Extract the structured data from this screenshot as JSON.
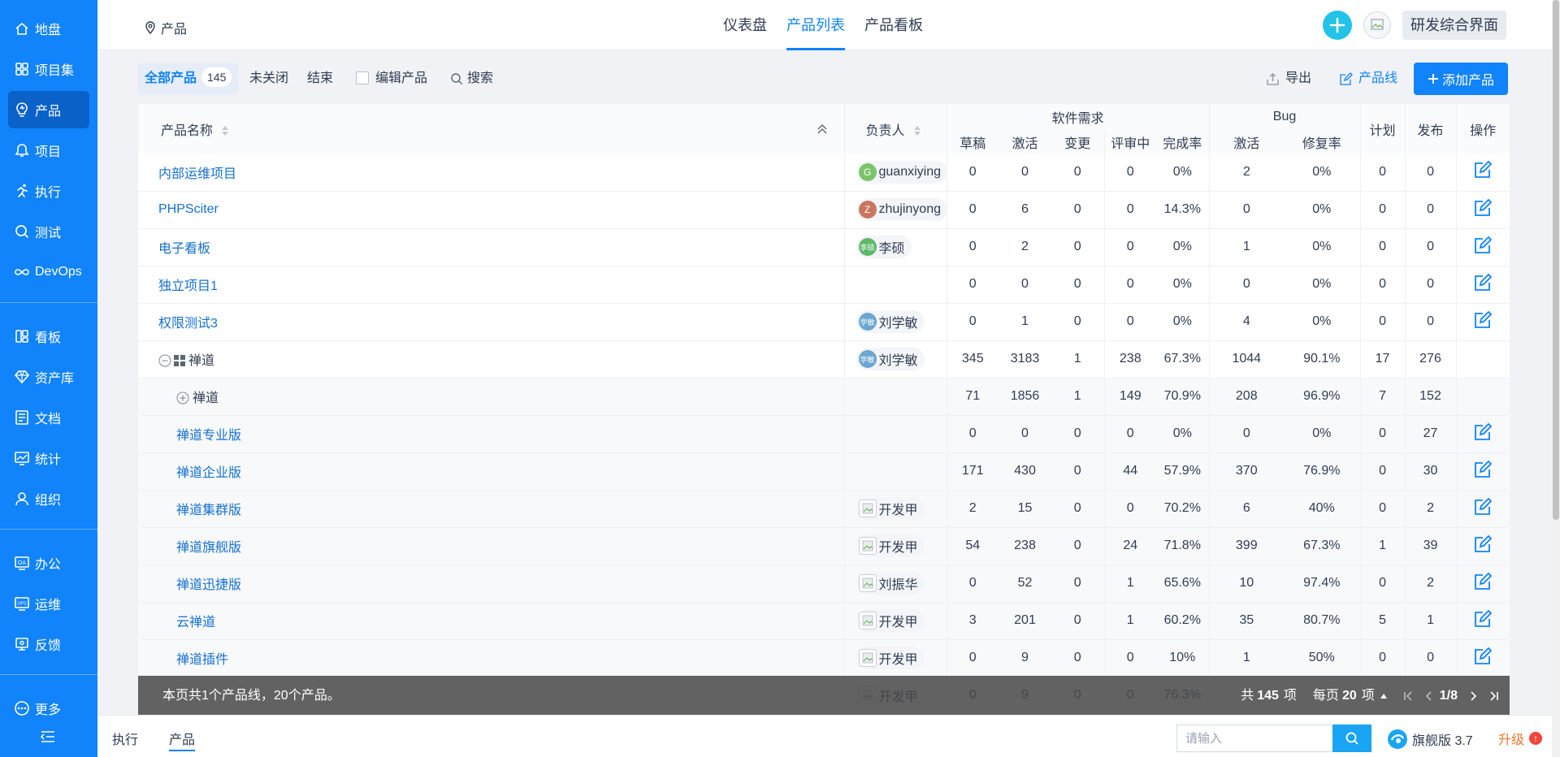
{
  "sidebar": {
    "groups": [
      [
        {
          "label": "地盘",
          "icon": "home-icon",
          "active": false
        },
        {
          "label": "项目集",
          "icon": "grid-icon",
          "active": false
        },
        {
          "label": "产品",
          "icon": "bulb-icon",
          "active": true
        },
        {
          "label": "项目",
          "icon": "bell-icon",
          "active": false
        },
        {
          "label": "执行",
          "icon": "run-icon",
          "active": false
        },
        {
          "label": "测试",
          "icon": "search-icon",
          "active": false
        },
        {
          "label": "DevOps",
          "icon": "infinity-icon",
          "active": false
        }
      ],
      [
        {
          "label": "看板",
          "icon": "board-icon",
          "active": false
        },
        {
          "label": "资产库",
          "icon": "diamond-icon",
          "active": false
        },
        {
          "label": "文档",
          "icon": "document-icon",
          "active": false
        },
        {
          "label": "统计",
          "icon": "chart-icon",
          "active": false
        },
        {
          "label": "组织",
          "icon": "user-icon",
          "active": false
        }
      ],
      [
        {
          "label": "办公",
          "icon": "oa-icon",
          "active": false
        },
        {
          "label": "运维",
          "icon": "ops-icon",
          "active": false
        },
        {
          "label": "反馈",
          "icon": "feedback-icon",
          "active": false
        }
      ],
      [
        {
          "label": "更多",
          "icon": "more-icon",
          "active": false
        }
      ]
    ]
  },
  "header": {
    "module": "产品",
    "tabs": [
      {
        "label": "仪表盘",
        "active": false
      },
      {
        "label": "产品列表",
        "active": true
      },
      {
        "label": "产品看板",
        "active": false
      }
    ],
    "workspace": "研发综合界面"
  },
  "toolbar": {
    "filters": {
      "all": "全部产品",
      "all_count": "145",
      "unclosed": "未关闭",
      "closed": "结束",
      "edit": "编辑产品",
      "search": "搜索"
    },
    "export": "导出",
    "product_line": "产品线",
    "add": "添加产品"
  },
  "table": {
    "headers": {
      "name": "产品名称",
      "owner": "负责人",
      "story_group": "软件需求",
      "bug_group": "Bug",
      "draft": "草稿",
      "active": "激活",
      "changed": "变更",
      "reviewing": "评审中",
      "completion": "完成率",
      "bug_active": "激活",
      "fix_rate": "修复率",
      "plan": "计划",
      "release": "发布",
      "actions": "操作"
    },
    "rows": [
      {
        "type": "product",
        "level": 0,
        "name": "内部运维项目",
        "owner": "guanxiying",
        "avatar_text": "G",
        "avatar_color": "#7cc36a",
        "draft": "0",
        "active": "0",
        "changed": "0",
        "reviewing": "0",
        "completion": "0%",
        "bug_active": "2",
        "fix_rate": "0%",
        "plan": "0",
        "release": "0",
        "editable": true
      },
      {
        "type": "product",
        "level": 0,
        "name": "PHPSciter",
        "owner": "zhujinyong",
        "avatar_text": "Z",
        "avatar_color": "#c9765e",
        "draft": "0",
        "active": "6",
        "changed": "0",
        "reviewing": "0",
        "completion": "14.3%",
        "bug_active": "0",
        "fix_rate": "0%",
        "plan": "0",
        "release": "0",
        "editable": true
      },
      {
        "type": "product",
        "level": 0,
        "name": "电子看板",
        "owner": "李硕",
        "avatar_text": "李硕",
        "avatar_color": "#5db86a",
        "draft": "0",
        "active": "2",
        "changed": "0",
        "reviewing": "0",
        "completion": "0%",
        "bug_active": "1",
        "fix_rate": "0%",
        "plan": "0",
        "release": "0",
        "editable": true
      },
      {
        "type": "product",
        "level": 0,
        "name": "独立项目1",
        "owner": "",
        "avatar_text": "",
        "avatar_color": "",
        "draft": "0",
        "active": "0",
        "changed": "0",
        "reviewing": "0",
        "completion": "0%",
        "bug_active": "0",
        "fix_rate": "0%",
        "plan": "0",
        "release": "0",
        "editable": true
      },
      {
        "type": "product",
        "level": 0,
        "name": "权限测试3",
        "owner": "刘学敏",
        "avatar_text": "学敏",
        "avatar_color": "#6aa6cf",
        "draft": "0",
        "active": "1",
        "changed": "0",
        "reviewing": "0",
        "completion": "0%",
        "bug_active": "4",
        "fix_rate": "0%",
        "plan": "0",
        "release": "0",
        "editable": true
      },
      {
        "type": "program",
        "level": 0,
        "name": "禅道",
        "owner": "刘学敏",
        "avatar_text": "学敏",
        "avatar_color": "#6aa6cf",
        "draft": "345",
        "active": "3183",
        "changed": "1",
        "reviewing": "238",
        "completion": "67.3%",
        "bug_active": "1044",
        "fix_rate": "90.1%",
        "plan": "17",
        "release": "276",
        "editable": false
      },
      {
        "type": "line",
        "level": 1,
        "name": "禅道",
        "owner": "",
        "avatar_text": "",
        "avatar_color": "",
        "draft": "71",
        "active": "1856",
        "changed": "1",
        "reviewing": "149",
        "completion": "70.9%",
        "bug_active": "208",
        "fix_rate": "96.9%",
        "plan": "7",
        "release": "152",
        "editable": false
      },
      {
        "type": "product",
        "level": 1,
        "name": "禅道专业版",
        "owner": "",
        "avatar_text": "",
        "avatar_color": "",
        "draft": "0",
        "active": "0",
        "changed": "0",
        "reviewing": "0",
        "completion": "0%",
        "bug_active": "0",
        "fix_rate": "0%",
        "plan": "0",
        "release": "27",
        "editable": true
      },
      {
        "type": "product",
        "level": 1,
        "name": "禅道企业版",
        "owner": "",
        "avatar_text": "",
        "avatar_color": "",
        "draft": "171",
        "active": "430",
        "changed": "0",
        "reviewing": "44",
        "completion": "57.9%",
        "bug_active": "370",
        "fix_rate": "76.9%",
        "plan": "0",
        "release": "30",
        "editable": true
      },
      {
        "type": "product",
        "level": 1,
        "name": "禅道集群版",
        "owner": "开发甲",
        "avatar_text": "img",
        "avatar_color": "",
        "draft": "2",
        "active": "15",
        "changed": "0",
        "reviewing": "0",
        "completion": "70.2%",
        "bug_active": "6",
        "fix_rate": "40%",
        "plan": "0",
        "release": "2",
        "editable": true
      },
      {
        "type": "product",
        "level": 1,
        "name": "禅道旗舰版",
        "owner": "开发甲",
        "avatar_text": "img",
        "avatar_color": "",
        "draft": "54",
        "active": "238",
        "changed": "0",
        "reviewing": "24",
        "completion": "71.8%",
        "bug_active": "399",
        "fix_rate": "67.3%",
        "plan": "1",
        "release": "39",
        "editable": true
      },
      {
        "type": "product",
        "level": 1,
        "name": "禅道迅捷版",
        "owner": "刘振华",
        "avatar_text": "img",
        "avatar_color": "",
        "draft": "0",
        "active": "52",
        "changed": "0",
        "reviewing": "1",
        "completion": "65.6%",
        "bug_active": "10",
        "fix_rate": "97.4%",
        "plan": "0",
        "release": "2",
        "editable": true
      },
      {
        "type": "product",
        "level": 1,
        "name": "云禅道",
        "owner": "开发甲",
        "avatar_text": "img",
        "avatar_color": "",
        "draft": "3",
        "active": "201",
        "changed": "0",
        "reviewing": "1",
        "completion": "60.2%",
        "bug_active": "35",
        "fix_rate": "80.7%",
        "plan": "5",
        "release": "1",
        "editable": true
      },
      {
        "type": "product",
        "level": 1,
        "name": "禅道插件",
        "owner": "开发甲",
        "avatar_text": "img",
        "avatar_color": "",
        "draft": "0",
        "active": "9",
        "changed": "0",
        "reviewing": "0",
        "completion": "10%",
        "bug_active": "1",
        "fix_rate": "50%",
        "plan": "0",
        "release": "0",
        "editable": true
      },
      {
        "type": "product",
        "level": 1,
        "name": "",
        "owner": "开发甲",
        "avatar_text": "img",
        "avatar_color": "",
        "draft": "0",
        "active": "9",
        "changed": "0",
        "reviewing": "0",
        "completion": "76.3%",
        "bug_active": "",
        "fix_rate": "",
        "plan": "",
        "release": "",
        "editable": false
      }
    ]
  },
  "footer": {
    "summary": "本页共1个产品线，20个产品。",
    "total_prefix": "共",
    "total": "145",
    "total_suffix": "项",
    "per_page_prefix": "每页",
    "per_page": "20",
    "per_page_suffix": "项",
    "page": "1/8"
  },
  "bottombar": {
    "tabs": [
      {
        "label": "执行",
        "active": false
      },
      {
        "label": "产品",
        "active": true
      }
    ],
    "search_placeholder": "请输入",
    "edition": "旗舰版 3.7",
    "upgrade": "升级"
  },
  "colors": {
    "primary": "#1183fb",
    "sidebar": "#1183fb",
    "sidebar_active": "#0a62c9",
    "link": "#1570d1",
    "accent_cyan": "#21c3e8"
  }
}
